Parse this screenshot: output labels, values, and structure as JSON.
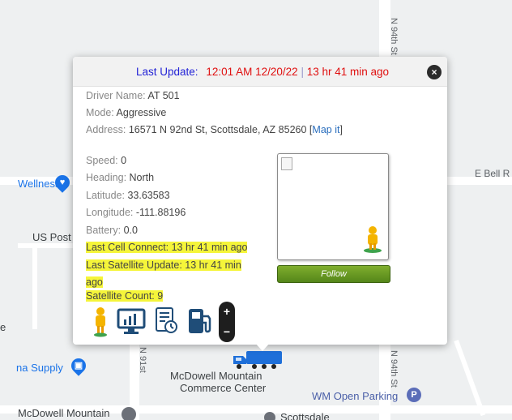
{
  "map": {
    "streets": {
      "n94th_top": "N 94th St",
      "e_bell": "E Bell R",
      "n91st": "N 91st",
      "n94th_bottom": "N 94th St"
    },
    "places": {
      "wellness": "Wellness",
      "us_post": "US Post",
      "supply": "na Supply",
      "mcdowell_center": "McDowell Mountain",
      "commerce": "Commerce Center",
      "wm_parking": "WM Open Parking",
      "mcdowell_bottom": "McDowell Mountain",
      "scottsdale": "Scottsdale",
      "edge_e": "e"
    },
    "parking_glyph": "P"
  },
  "popup": {
    "header": {
      "label": "Last Update:",
      "datetime": "12:01 AM 12/20/22",
      "sep": "|",
      "ago": "13 hr 41 min ago"
    },
    "driver": {
      "k": "Driver Name:",
      "v": "AT 501"
    },
    "mode": {
      "k": "Mode:",
      "v": "Aggressive"
    },
    "address": {
      "k": "Address:",
      "v": "16571 N 92nd St, Scottsdale, AZ 85260",
      "open": "[",
      "link": "Map it",
      "close": "]"
    },
    "speed": {
      "k": "Speed:",
      "v": "0"
    },
    "heading": {
      "k": "Heading:",
      "v": "North"
    },
    "latitude": {
      "k": "Latitude:",
      "v": "33.63583"
    },
    "longitude": {
      "k": "Longitude:",
      "v": "-111.88196"
    },
    "battery": {
      "k": "Battery:",
      "v": "0.0"
    },
    "cell": "Last Cell Connect: 13 hr 41 min ago",
    "sat_line1": "Last Satellite Update: 13 hr 41 min",
    "sat_line2": "ago",
    "sat_count": "Satellite Count: 9",
    "follow": "Follow",
    "zoom_in": "+",
    "zoom_out": "−",
    "close": "×"
  },
  "colors": {
    "header_label": "#2323d6",
    "header_time": "#e01010",
    "highlight": "#f5f53a",
    "follow_green": "#6a9c22",
    "truck_blue": "#1e6fd9"
  }
}
